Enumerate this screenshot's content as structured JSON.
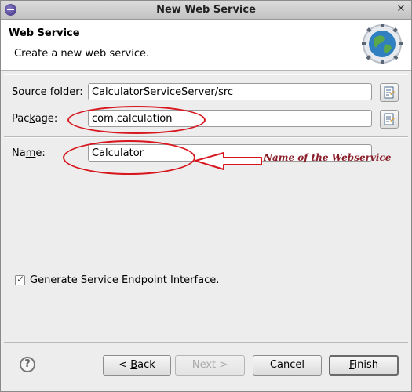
{
  "window": {
    "title": "New Web Service"
  },
  "header": {
    "title": "Web Service",
    "description": "Create a new web service."
  },
  "form": {
    "source_folder": {
      "label_pre": "Source fo",
      "label_mn": "l",
      "label_post": "der:",
      "value": "CalculatorServiceServer/src"
    },
    "package": {
      "label_pre": "Pac",
      "label_mn": "k",
      "label_post": "age:",
      "value": "com.calculation"
    },
    "name": {
      "label_pre": "Na",
      "label_mn": "m",
      "label_post": "e:",
      "value": "Calculator"
    },
    "generate_sei": {
      "label": "Generate Service Endpoint Interface.",
      "checked": true
    }
  },
  "annotation": {
    "text": "Name of the Webservice",
    "color": "#8a1d2a",
    "ellipse_color": "#d7161e"
  },
  "buttons": {
    "back_pre": "< ",
    "back_mn": "B",
    "back_post": "ack",
    "next": "Next >",
    "cancel": "Cancel",
    "finish_mn": "F",
    "finish_post": "inish"
  },
  "icons": {
    "help": "help-icon",
    "globe": "globe-icon",
    "browse": "browse-icon"
  }
}
